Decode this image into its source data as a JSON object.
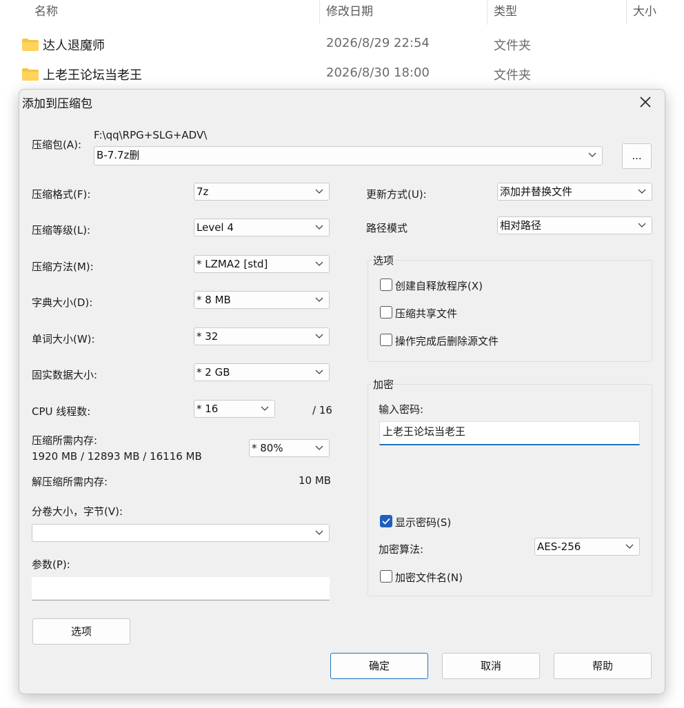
{
  "explorer": {
    "columns": {
      "name": "名称",
      "modified": "修改日期",
      "type": "类型",
      "size": "大小"
    },
    "rows": [
      {
        "name": "达人退魔师",
        "date": "2026/8/29 22:54",
        "type": "文件夹"
      },
      {
        "name": "上老王论坛当老王",
        "date": "2026/8/30 18:00",
        "type": "文件夹"
      }
    ]
  },
  "dialog": {
    "title": "添加到压缩包",
    "archive": {
      "label": "压缩包(A):",
      "path": "F:\\qq\\RPG+SLG+ADV\\",
      "filename": "B-7.7z删",
      "browse_label": "..."
    },
    "left": {
      "format": {
        "label": "压缩格式(F):",
        "value": "7z"
      },
      "level": {
        "label": "压缩等级(L):",
        "value": "Level 4"
      },
      "method": {
        "label": "压缩方法(M):",
        "value": "*  LZMA2 [std]"
      },
      "dict": {
        "label": "字典大小(D):",
        "value": "*  8 MB"
      },
      "word": {
        "label": "单词大小(W):",
        "value": "*  32"
      },
      "solid": {
        "label": "固实数据大小:",
        "value": "*  2 GB"
      },
      "threads": {
        "label": "CPU 线程数:",
        "value": "*  16",
        "max": "/ 16"
      },
      "mem": {
        "label": "压缩所需内存:",
        "detail": "1920 MB / 12893 MB / 16116 MB",
        "value": "* 80%"
      },
      "decomp": {
        "label": "解压缩所需内存:",
        "value": "10 MB"
      },
      "volume": {
        "label": "分卷大小，字节(V):",
        "value": ""
      },
      "params": {
        "label": "参数(P):",
        "value": ""
      },
      "options_button": "选项"
    },
    "right": {
      "update": {
        "label": "更新方式(U):",
        "value": "添加并替换文件"
      },
      "pathmode": {
        "label": "路径模式",
        "value": "相对路径"
      },
      "options": {
        "title": "选项",
        "sfx": "创建自释放程序(X)",
        "shared": "压缩共享文件",
        "delete": "操作完成后删除源文件"
      },
      "encryption": {
        "title": "加密",
        "password_label": "输入密码:",
        "password": "上老王论坛当老王",
        "show_password": "显示密码(S)",
        "method_label": "加密算法:",
        "method": "AES-256",
        "encrypt_names": "加密文件名(N)"
      }
    },
    "buttons": {
      "ok": "确定",
      "cancel": "取消",
      "help": "帮助"
    }
  }
}
